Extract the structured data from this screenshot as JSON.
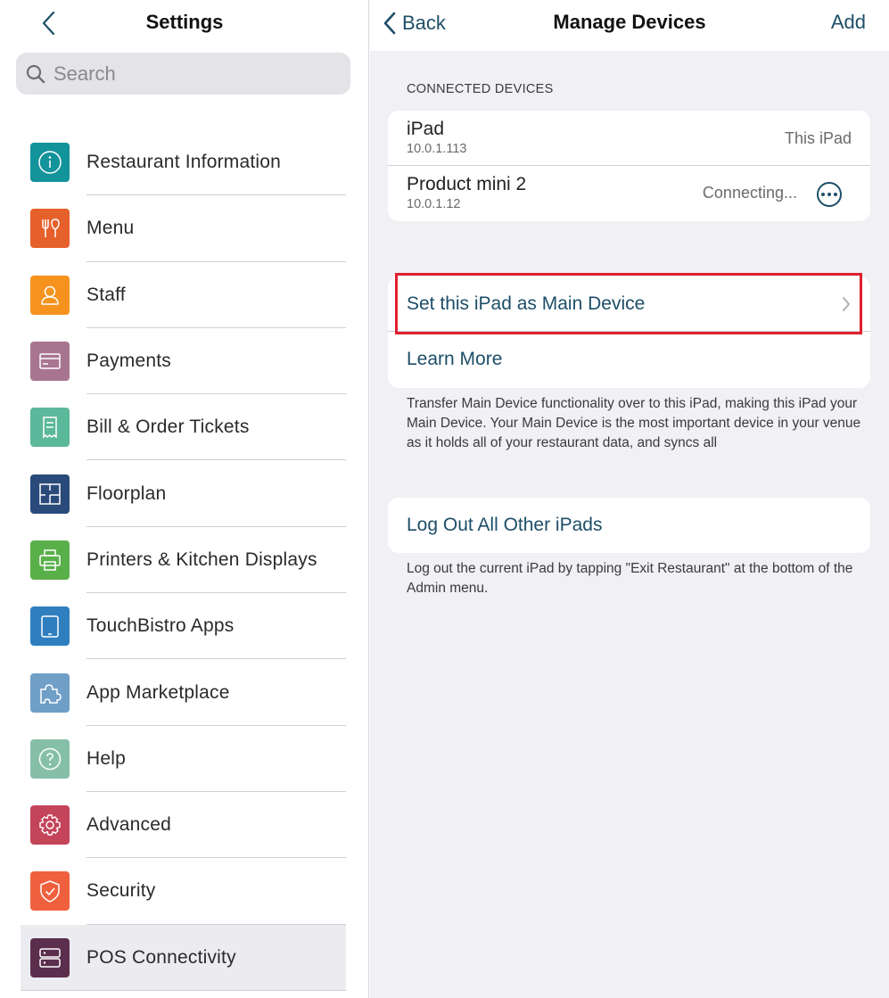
{
  "left": {
    "title": "Settings",
    "search_placeholder": "Search",
    "items": [
      {
        "label": "Restaurant Information",
        "icon": "info-icon",
        "color": "#13939a"
      },
      {
        "label": "Menu",
        "icon": "fork-knife-icon",
        "color": "#e6602b"
      },
      {
        "label": "Staff",
        "icon": "person-icon",
        "color": "#f5931e"
      },
      {
        "label": "Payments",
        "icon": "card-icon",
        "color": "#a87590"
      },
      {
        "label": "Bill & Order Tickets",
        "icon": "receipt-icon",
        "color": "#5cb89a"
      },
      {
        "label": "Floorplan",
        "icon": "floorplan-icon",
        "color": "#2a4a7a"
      },
      {
        "label": "Printers & Kitchen Displays",
        "icon": "printer-icon",
        "color": "#59b04a"
      },
      {
        "label": "TouchBistro Apps",
        "icon": "tablet-icon",
        "color": "#2f7fbf"
      },
      {
        "label": "App Marketplace",
        "icon": "puzzle-icon",
        "color": "#6f9fc7"
      },
      {
        "label": "Help",
        "icon": "help-icon",
        "color": "#86bfa8"
      },
      {
        "label": "Advanced",
        "icon": "gear-icon",
        "color": "#c4445a"
      },
      {
        "label": "Security",
        "icon": "shield-icon",
        "color": "#f0603e"
      },
      {
        "label": "POS Connectivity",
        "icon": "server-icon",
        "color": "#5a2e4c"
      }
    ]
  },
  "right": {
    "back_label": "Back",
    "title": "Manage Devices",
    "add_label": "Add",
    "section_label": "CONNECTED DEVICES",
    "devices": [
      {
        "name": "iPad",
        "ip": "10.0.1.113",
        "status": "This iPad"
      },
      {
        "name": "Product mini 2",
        "ip": "10.0.1.12",
        "status": "Connecting..."
      }
    ],
    "set_main_label": "Set this iPad as Main Device",
    "learn_more_label": "Learn More",
    "transfer_note": "Transfer Main Device functionality over to this iPad, making this iPad your Main Device. Your Main Device is the most important device in your venue as it holds all of your restaurant data, and syncs all",
    "logout_label": "Log Out All Other iPads",
    "logout_note": "Log out the current iPad by tapping \"Exit Restaurant\" at the bottom of the Admin menu."
  },
  "colors": {
    "accent": "#1d4e68",
    "highlight": "#e0202e"
  }
}
